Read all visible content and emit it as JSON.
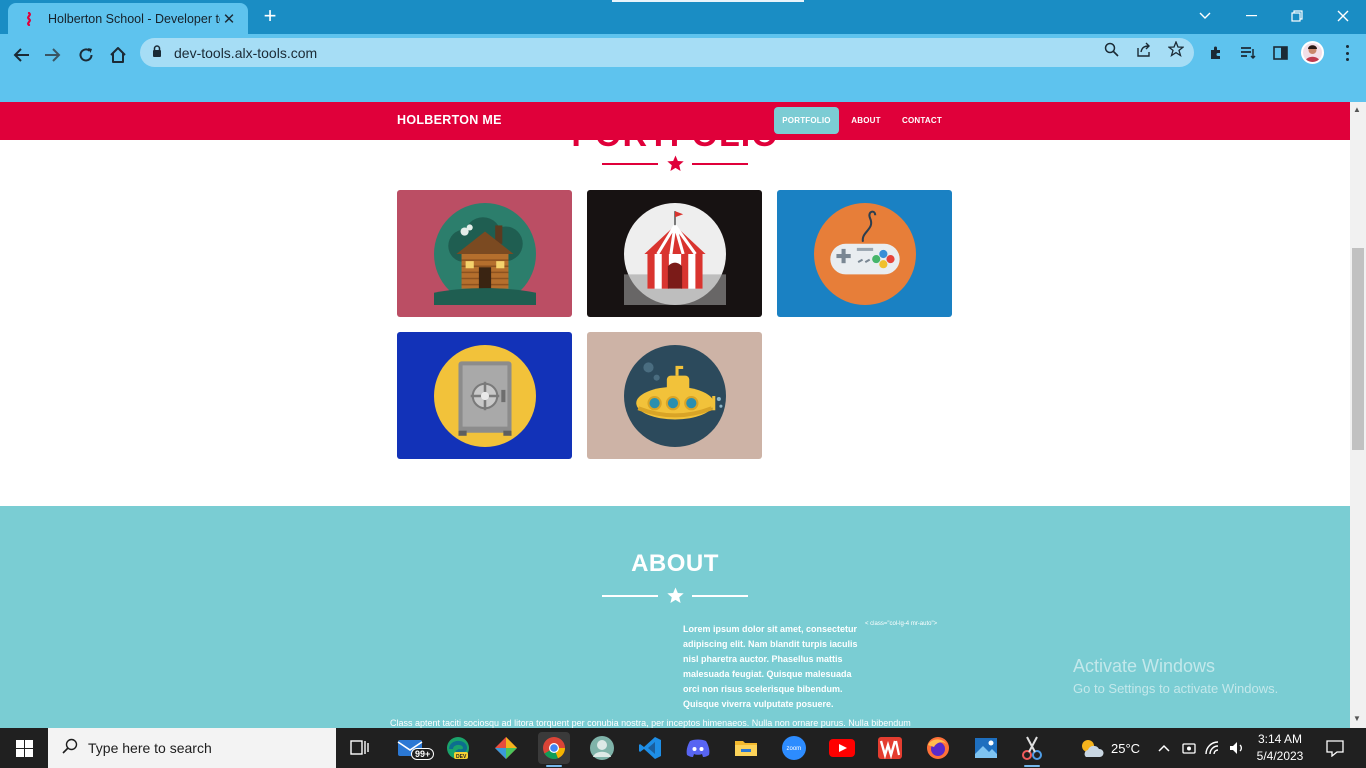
{
  "browser": {
    "tab_title": "Holberton School - Developer to",
    "url": "dev-tools.alx-tools.com"
  },
  "site": {
    "brand": "HOLBERTON ME",
    "nav": [
      {
        "label": "PORTFOLIO",
        "active": true
      },
      {
        "label": "ABOUT",
        "active": false
      },
      {
        "label": "CONTACT",
        "active": false
      }
    ],
    "portfolio_heading": "PORTFOLIO",
    "portfolio_items": [
      {
        "name": "cabin",
        "bg": "#bb4e64"
      },
      {
        "name": "circus-tent",
        "bg": "#171212"
      },
      {
        "name": "game-controller",
        "bg": "#1a81c3"
      },
      {
        "name": "safe",
        "bg": "#1232b8"
      },
      {
        "name": "submarine",
        "bg": "#cdb3a6"
      }
    ],
    "about": {
      "heading": "ABOUT",
      "col1": "Lorem ipsum dolor sit amet, consectetur adipiscing elit. Nam blandit turpis iaculis nisl pharetra auctor. Phasellus mattis malesuada feugiat. Quisque malesuada orci non risus scelerisque bibendum. Quisque viverra vulputate posuere.",
      "note": "< class=\"col-lg-4 mr-auto\">",
      "col2": "Class aptent taciti sociosqu ad litora torquent per conubia nostra, per inceptos himenaeos. Nulla non ornare purus. Nulla bibendum"
    }
  },
  "watermark": {
    "line1": "Activate Windows",
    "line2": "Go to Settings to activate Windows."
  },
  "taskbar": {
    "search_placeholder": "Type here to search",
    "mail_badge": "99+",
    "weather": "25°C",
    "time": "3:14 AM",
    "date": "5/4/2023"
  },
  "colors": {
    "accent_red": "#e0003a",
    "teal": "#7acdd3",
    "chrome_blue": "#5ec3ee"
  }
}
